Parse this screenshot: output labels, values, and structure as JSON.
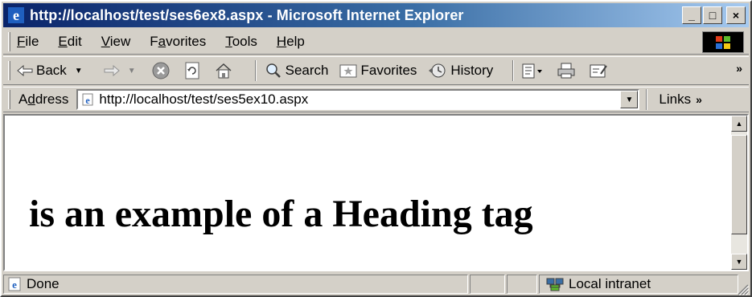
{
  "window": {
    "title": "http://localhost/test/ses6ex8.aspx - Microsoft Internet Explorer",
    "min_label": "_",
    "max_label": "□",
    "close_label": "×"
  },
  "menu": {
    "items": [
      {
        "pre": "",
        "key": "F",
        "post": "ile"
      },
      {
        "pre": "",
        "key": "E",
        "post": "dit"
      },
      {
        "pre": "",
        "key": "V",
        "post": "iew"
      },
      {
        "pre": "F",
        "key": "a",
        "post": "vorites"
      },
      {
        "pre": "",
        "key": "T",
        "post": "ools"
      },
      {
        "pre": "",
        "key": "H",
        "post": "elp"
      }
    ]
  },
  "toolbar": {
    "back_label": "Back",
    "search_label": "Search",
    "favorites_label": "Favorites",
    "history_label": "History",
    "more_label": "»"
  },
  "address": {
    "label_pre": "A",
    "label_key": "d",
    "label_post": "dress",
    "url": "http://localhost/test/ses5ex10.aspx",
    "links_label": "Links",
    "links_more": "»"
  },
  "content": {
    "heading": "is an example of a Heading tag"
  },
  "status": {
    "text": "Done",
    "zone": "Local intranet"
  },
  "colors": {
    "titlebar_start": "#0a246a",
    "titlebar_end": "#a6caf0",
    "chrome": "#d4d0c8"
  },
  "icons": {
    "ie": "ie-logo-icon",
    "back": "back-arrow-icon",
    "forward": "forward-arrow-icon",
    "stop": "stop-icon",
    "refresh": "refresh-icon",
    "home": "home-icon",
    "search": "search-icon",
    "favorites": "favorites-icon",
    "history": "history-icon",
    "mail": "mail-icon",
    "print": "print-icon",
    "edit": "edit-icon"
  }
}
